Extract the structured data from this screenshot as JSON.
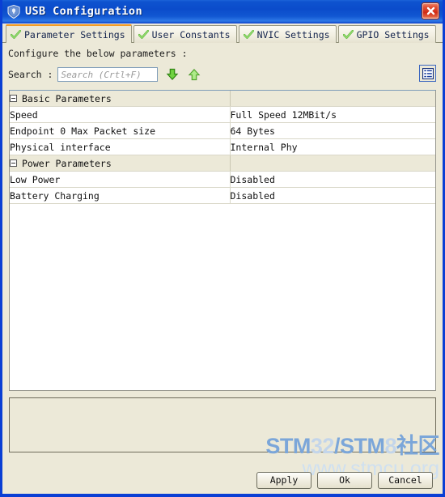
{
  "window": {
    "title": "USB Configuration",
    "app_icon": "shield-icon",
    "close_label": "✕"
  },
  "tabs": [
    {
      "label": "Parameter Settings",
      "icon": "green-check-icon",
      "active": true
    },
    {
      "label": "User Constants",
      "icon": "green-check-icon",
      "active": false
    },
    {
      "label": "NVIC Settings",
      "icon": "green-check-icon",
      "active": false
    },
    {
      "label": "GPIO Settings",
      "icon": "green-check-icon",
      "active": false
    }
  ],
  "pane": {
    "instruction": "Configure the below parameters :"
  },
  "search": {
    "label": "Search :",
    "placeholder": "Search (Crtl+F)",
    "value": "",
    "down_icon": "green-down-arrow-icon",
    "up_icon": "green-up-arrow-icon",
    "view_toggle_icon": "list-view-icon"
  },
  "table": {
    "groups": [
      {
        "name": "Basic Parameters",
        "rows": [
          {
            "name": "Speed",
            "value": "Full Speed 12MBit/s"
          },
          {
            "name": "Endpoint 0 Max Packet size",
            "value": "64 Bytes"
          },
          {
            "name": "Physical interface",
            "value": "Internal Phy"
          }
        ]
      },
      {
        "name": "Power Parameters",
        "rows": [
          {
            "name": "Low Power",
            "value": "Disabled"
          },
          {
            "name": "Battery Charging",
            "value": "Disabled"
          }
        ]
      }
    ]
  },
  "description_panel": {
    "text": ""
  },
  "watermark": {
    "line1_parts": [
      {
        "text": "STM",
        "style": "bold"
      },
      {
        "text": "32",
        "style": "light"
      },
      {
        "text": "/",
        "style": "bold"
      },
      {
        "text": "STM",
        "style": "bold"
      },
      {
        "text": "8",
        "style": "light"
      },
      {
        "text": "社区",
        "style": "bold"
      }
    ],
    "line2": "www.stmcu.org"
  },
  "buttons": {
    "apply": "Apply",
    "ok": "Ok",
    "cancel": "Cancel"
  },
  "colors": {
    "title_bar": "#0b4ccb",
    "window_border": "#0a3fd4",
    "face": "#ece9d8",
    "active_tab_accent": "#f29b25",
    "check_green": "#5fbb3c",
    "close_red": "#cf2b15",
    "watermark_blue": "#7ba6d9"
  }
}
